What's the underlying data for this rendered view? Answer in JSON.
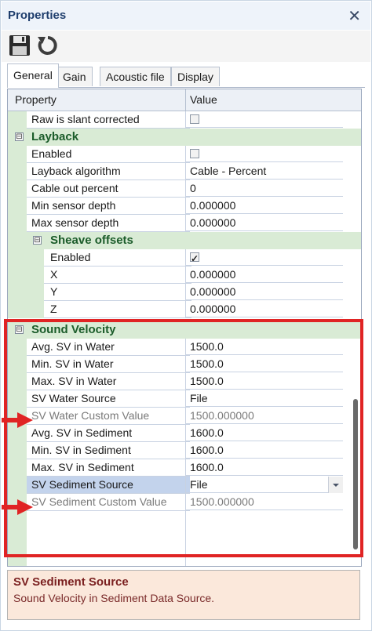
{
  "window": {
    "title": "Properties",
    "close_glyph": "✕"
  },
  "toolbar": {
    "save_icon": "save-icon",
    "reset_icon": "reset-icon"
  },
  "tabs": [
    {
      "label": "General",
      "active": true
    },
    {
      "label": "Gain",
      "active": false
    },
    {
      "label": "Acoustic file",
      "active": false
    },
    {
      "label": "Display",
      "active": false
    }
  ],
  "grid": {
    "col_property": "Property",
    "col_value": "Value"
  },
  "rows": {
    "raw_slant": {
      "name": "Raw is slant corrected",
      "checked": false
    },
    "layback": {
      "name": "Layback",
      "expander": "⊟"
    },
    "lb_enabled": {
      "name": "Enabled",
      "checked": false
    },
    "lb_algorithm": {
      "name": "Layback algorithm",
      "value": "Cable - Percent"
    },
    "lb_cable": {
      "name": "Cable out percent",
      "value": "0"
    },
    "lb_min": {
      "name": "Min sensor depth",
      "value": "0.000000"
    },
    "lb_max": {
      "name": "Max sensor depth",
      "value": "0.000000"
    },
    "sheave": {
      "name": "Sheave offsets",
      "expander": "⊟"
    },
    "sh_enabled": {
      "name": "Enabled",
      "checked": true
    },
    "sh_x": {
      "name": "X",
      "value": "0.000000"
    },
    "sh_y": {
      "name": "Y",
      "value": "0.000000"
    },
    "sh_z": {
      "name": "Z",
      "value": "0.000000"
    },
    "sound": {
      "name": "Sound Velocity",
      "expander": "⊟"
    },
    "sv_avg_water": {
      "name": "Avg. SV in Water",
      "value": "1500.0"
    },
    "sv_min_water": {
      "name": "Min. SV in Water",
      "value": "1500.0"
    },
    "sv_max_water": {
      "name": "Max. SV in Water",
      "value": "1500.0"
    },
    "sv_water_src": {
      "name": "SV Water Source",
      "value": "File"
    },
    "sv_water_custom": {
      "name": "SV Water Custom Value",
      "value": "1500.000000"
    },
    "sv_avg_sed": {
      "name": "Avg. SV in Sediment",
      "value": "1600.0"
    },
    "sv_min_sed": {
      "name": "Min. SV in Sediment",
      "value": "1600.0"
    },
    "sv_max_sed": {
      "name": "Max. SV in Sediment",
      "value": "1600.0"
    },
    "sv_sed_src": {
      "name": "SV Sediment Source",
      "value": "File"
    },
    "sv_sed_custom": {
      "name": "SV Sediment Custom Value",
      "value": "1500.000000"
    }
  },
  "description": {
    "title": "SV Sediment Source",
    "text": "Sound Velocity in Sediment Data Source."
  },
  "colors": {
    "category_bg": "#d9ebd5",
    "category_text": "#1b5c2a",
    "selection_bg": "#c3d3ec",
    "highlight_red": "#e02424",
    "description_bg": "#fbe8db"
  }
}
